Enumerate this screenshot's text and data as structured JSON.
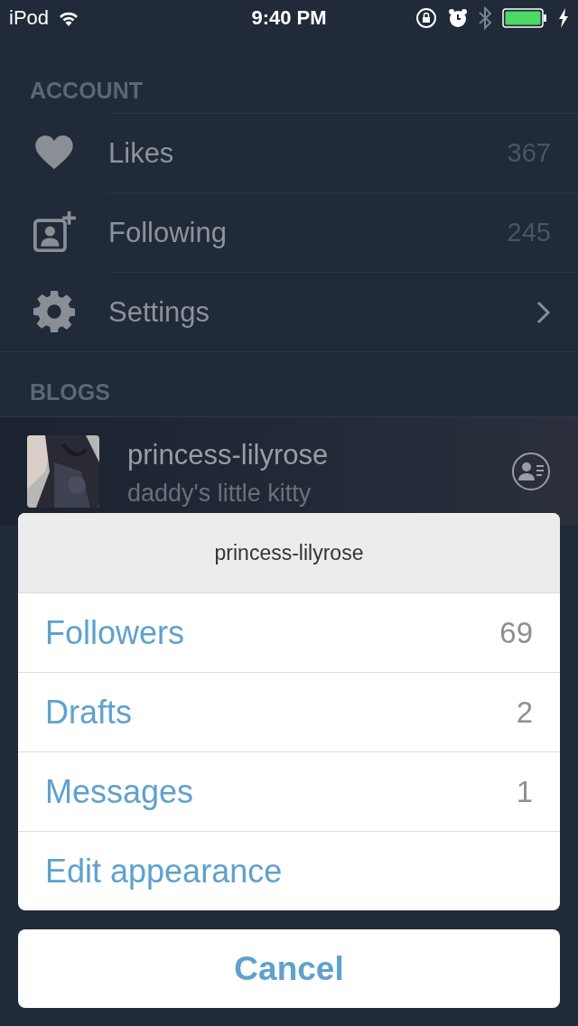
{
  "status_bar": {
    "carrier": "iPod",
    "time": "9:40 PM",
    "charging": true
  },
  "account": {
    "header": "ACCOUNT",
    "items": [
      {
        "kind": "count",
        "label": "Likes",
        "count": "367"
      },
      {
        "kind": "count",
        "label": "Following",
        "count": "245"
      },
      {
        "kind": "link",
        "label": "Settings"
      }
    ]
  },
  "blogs": {
    "header": "BLOGS",
    "items": [
      {
        "name": "princess-lilyrose",
        "subtitle": "daddy's little kitty"
      }
    ]
  },
  "action_sheet": {
    "title": "princess-lilyrose",
    "items": [
      {
        "label": "Followers",
        "count": "69"
      },
      {
        "label": "Drafts",
        "count": "2"
      },
      {
        "label": "Messages",
        "count": "1"
      },
      {
        "label": "Edit appearance"
      }
    ],
    "cancel": "Cancel"
  }
}
